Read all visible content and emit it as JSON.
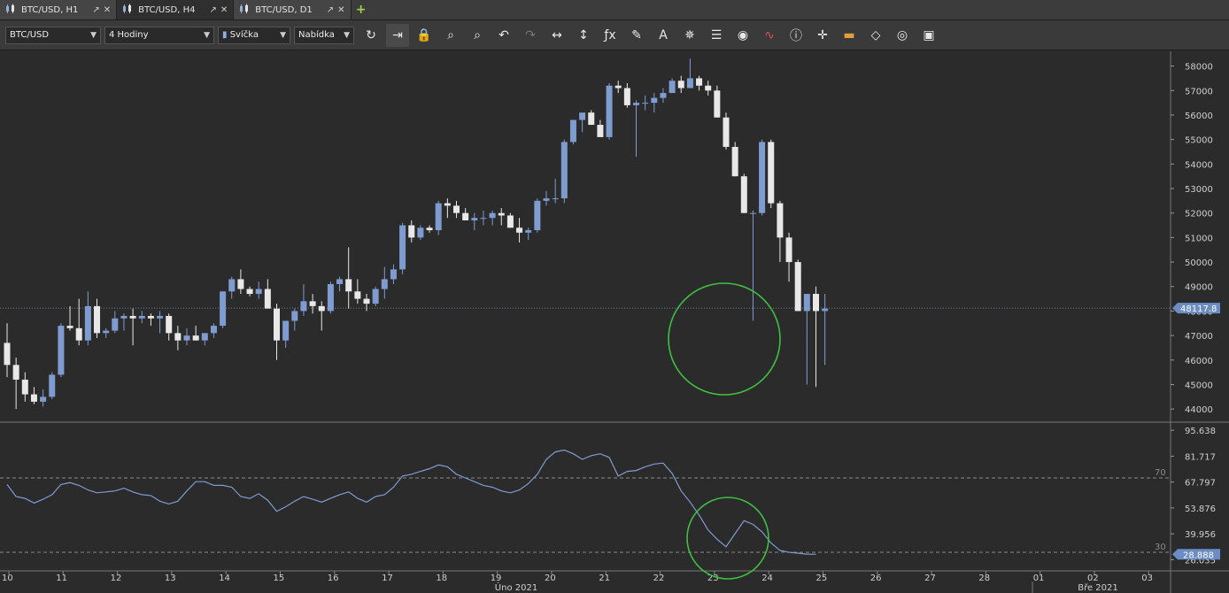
{
  "tabs": [
    {
      "label": "BTC/USD, H1",
      "active": false
    },
    {
      "label": "BTC/USD, H4",
      "active": true
    },
    {
      "label": "BTC/USD, D1",
      "active": false
    }
  ],
  "toolbar": {
    "symbol": "BTC/USD",
    "timeframe": "4 Hodiny",
    "chart_type": "Svíčka",
    "menu": "Nabídka",
    "icons": [
      "refresh-icon",
      "autoscroll-icon",
      "lock-icon",
      "zoom-in-icon",
      "zoom-out-icon",
      "undo-icon",
      "redo-icon",
      "horizontal-resize-icon",
      "vertical-resize-icon",
      "indicator-fx-icon",
      "pencil-icon",
      "text-tool-icon",
      "crosshair-tool-icon",
      "layers-icon",
      "eye-icon",
      "alert-chart-icon",
      "info-icon",
      "cursor-cross-icon",
      "color-bars-icon",
      "paint-bucket-icon",
      "settings-wheel-icon",
      "save-icon"
    ]
  },
  "chart_data": [
    {
      "type": "candlestick",
      "symbol": "BTC/USD",
      "timeframe": "H4",
      "ylim": [
        43500,
        58600
      ],
      "y_ticks": [
        44000,
        45000,
        46000,
        47000,
        48000,
        49000,
        50000,
        51000,
        52000,
        53000,
        54000,
        55000,
        56000,
        57000,
        58000
      ],
      "current_price_label": "48117.8",
      "current_price": 48117.8,
      "candles": [
        [
          46700,
          47500,
          45300,
          45800
        ],
        [
          45800,
          46100,
          44000,
          45200
        ],
        [
          45200,
          45500,
          44300,
          44600
        ],
        [
          44600,
          44900,
          44200,
          44300
        ],
        [
          44300,
          44800,
          44100,
          44500
        ],
        [
          44500,
          45500,
          44400,
          45400
        ],
        [
          45400,
          47500,
          45300,
          47400
        ],
        [
          47400,
          48200,
          47200,
          47300
        ],
        [
          47300,
          48500,
          46600,
          46800
        ],
        [
          46800,
          48800,
          46600,
          48200
        ],
        [
          48200,
          48500,
          46900,
          47100
        ],
        [
          47100,
          47300,
          46900,
          47200
        ],
        [
          47200,
          48000,
          47100,
          47700
        ],
        [
          47700,
          47900,
          47200,
          47800
        ],
        [
          47800,
          48100,
          46600,
          47700
        ],
        [
          47700,
          48000,
          47500,
          47800
        ],
        [
          47800,
          47900,
          47400,
          47700
        ],
        [
          47700,
          48000,
          47100,
          47800
        ],
        [
          47800,
          47900,
          46800,
          47100
        ],
        [
          47100,
          47400,
          46400,
          46800
        ],
        [
          46800,
          47300,
          46600,
          47000
        ],
        [
          47000,
          47400,
          46800,
          46800
        ],
        [
          46800,
          47100,
          46600,
          47100
        ],
        [
          47100,
          47500,
          46900,
          47400
        ],
        [
          47400,
          48800,
          47300,
          48800
        ],
        [
          48800,
          49400,
          48500,
          49300
        ],
        [
          49300,
          49700,
          48700,
          48900
        ],
        [
          48900,
          49000,
          48600,
          48700
        ],
        [
          48700,
          49200,
          48500,
          48900
        ],
        [
          48900,
          49300,
          48300,
          48100
        ],
        [
          48100,
          48300,
          46000,
          46800
        ],
        [
          46800,
          47600,
          46500,
          47600
        ],
        [
          47600,
          48100,
          47200,
          48000
        ],
        [
          48000,
          49100,
          47800,
          48400
        ],
        [
          48400,
          48700,
          47900,
          48200
        ],
        [
          48200,
          48400,
          47200,
          48000
        ],
        [
          48000,
          49200,
          47900,
          49100
        ],
        [
          49100,
          49400,
          48800,
          49300
        ],
        [
          49300,
          50600,
          48100,
          48800
        ],
        [
          48800,
          49300,
          48300,
          48500
        ],
        [
          48500,
          48700,
          48000,
          48300
        ],
        [
          48300,
          49000,
          48200,
          48900
        ],
        [
          48900,
          49800,
          48500,
          49300
        ],
        [
          49300,
          49900,
          49100,
          49700
        ],
        [
          49700,
          51600,
          49500,
          51500
        ],
        [
          51500,
          51700,
          50800,
          51000
        ],
        [
          51000,
          51500,
          50900,
          51400
        ],
        [
          51400,
          51500,
          51200,
          51300
        ],
        [
          51300,
          52500,
          51100,
          52400
        ],
        [
          52400,
          52600,
          51800,
          52300
        ],
        [
          52300,
          52500,
          51800,
          52000
        ],
        [
          52000,
          52200,
          51700,
          51700
        ],
        [
          51700,
          52000,
          51300,
          51800
        ],
        [
          51800,
          52100,
          51500,
          51800
        ],
        [
          51800,
          52100,
          51500,
          52000
        ],
        [
          52000,
          52200,
          51500,
          51900
        ],
        [
          51900,
          52000,
          51400,
          51400
        ],
        [
          51400,
          51800,
          50800,
          51200
        ],
        [
          51200,
          51400,
          50900,
          51300
        ],
        [
          51300,
          52600,
          51200,
          52500
        ],
        [
          52500,
          52900,
          52300,
          52600
        ],
        [
          52600,
          53400,
          52400,
          52600
        ],
        [
          52600,
          55000,
          52400,
          54900
        ],
        [
          54900,
          55800,
          54800,
          55800
        ],
        [
          55800,
          56100,
          55300,
          56100
        ],
        [
          56100,
          56200,
          55600,
          55600
        ],
        [
          55600,
          55800,
          55100,
          55100
        ],
        [
          55100,
          57300,
          55000,
          57200
        ],
        [
          57200,
          57400,
          56900,
          57100
        ],
        [
          57100,
          57300,
          56300,
          56400
        ],
        [
          56400,
          56600,
          54300,
          56500
        ],
        [
          56500,
          56800,
          56200,
          56500
        ],
        [
          56500,
          56900,
          56100,
          56700
        ],
        [
          56700,
          57100,
          56500,
          56900
        ],
        [
          56900,
          57500,
          56900,
          57400
        ],
        [
          57400,
          57600,
          56900,
          57100
        ],
        [
          57100,
          58300,
          57100,
          57500
        ],
        [
          57500,
          57600,
          57000,
          57200
        ],
        [
          57200,
          57400,
          56800,
          57000
        ],
        [
          57000,
          57200,
          55900,
          55900
        ],
        [
          55900,
          56100,
          54600,
          54700
        ],
        [
          54700,
          54900,
          53500,
          53500
        ],
        [
          53500,
          53600,
          52000,
          52000
        ],
        [
          52000,
          52100,
          47600,
          52000
        ],
        [
          52000,
          55000,
          51900,
          54900
        ],
        [
          54900,
          55000,
          52200,
          52400
        ],
        [
          52400,
          52500,
          50000,
          51000
        ],
        [
          51000,
          51200,
          49200,
          50000
        ],
        [
          50000,
          50100,
          48000,
          48000
        ],
        [
          48000,
          48700,
          45000,
          48700
        ],
        [
          48700,
          49000,
          44900,
          48000
        ],
        [
          48000,
          48700,
          45800,
          48100
        ]
      ],
      "x_ticks": [
        "10",
        "11",
        "12",
        "13",
        "14",
        "15",
        "16",
        "17",
        "18",
        "19",
        "20",
        "21",
        "22",
        "23",
        "24",
        "25",
        "26",
        "27",
        "28",
        "01",
        "02",
        "03"
      ],
      "x_sub_labels": [
        "Úno 2021",
        "Bře 2021"
      ],
      "annotations": [
        "circle"
      ]
    },
    {
      "type": "line",
      "indicator": "RSI",
      "ylim": [
        20,
        100
      ],
      "y_ticks": [
        95.638,
        81.717,
        67.797,
        53.876,
        39.956,
        26.035
      ],
      "levels": [
        70,
        30
      ],
      "current_value_label": "28.888",
      "series": [
        {
          "values": [
            66.5,
            60,
            59,
            56.5,
            58.5,
            61,
            66.5,
            67.5,
            66,
            63.5,
            62,
            62.5,
            63,
            64.5,
            62.5,
            61,
            60.5,
            57.5,
            56,
            57.5,
            63,
            68,
            68,
            66,
            66,
            65,
            60,
            59,
            61.5,
            58,
            52,
            54.5,
            57.5,
            60,
            58.5,
            57,
            59,
            61,
            62.5,
            59,
            57,
            60,
            61,
            65,
            71,
            72,
            73.5,
            75,
            77,
            76,
            72,
            70,
            68,
            66,
            65,
            63,
            62,
            63.5,
            67,
            72,
            80,
            84,
            85,
            83,
            80,
            82,
            83,
            81,
            71,
            73.5,
            74,
            76,
            77.5,
            78,
            72.5,
            63,
            57,
            50,
            42,
            37,
            33,
            40,
            47,
            45,
            41,
            35,
            31,
            30,
            29.5,
            29,
            28.9
          ]
        }
      ],
      "annotations": [
        "circle"
      ]
    }
  ]
}
